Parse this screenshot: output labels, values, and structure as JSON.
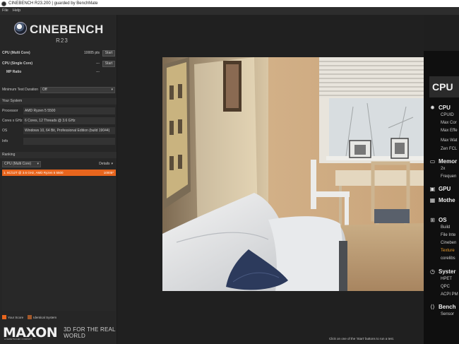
{
  "window": {
    "title": "CINEBENCH R23.200 | guarded by BenchMate"
  },
  "menu": {
    "items": [
      "File",
      "Help"
    ]
  },
  "logo": {
    "name": "CINEBENCH",
    "version": "R23"
  },
  "tests": {
    "multi": {
      "label": "CPU (Multi Core)",
      "score": "10005 pts",
      "button": "Start"
    },
    "single": {
      "label": "CPU (Single Core)",
      "score": "---",
      "button": "Start"
    },
    "ratio": {
      "label": "MP Ratio",
      "score": "---"
    }
  },
  "settings": {
    "duration_label": "Minimum Test Duration",
    "duration_value": "Off"
  },
  "system": {
    "header": "Your System",
    "rows": [
      {
        "label": "Processor",
        "value": "AMD Ryzen 5 5500"
      },
      {
        "label": "Cores x GHz",
        "value": "6 Cores, 12 Threads @ 3.6 GHz"
      },
      {
        "label": "OS",
        "value": "Windows 10, 64 Bit, Professional Edition (build 19044)"
      },
      {
        "label": "Info",
        "value": ""
      }
    ]
  },
  "ranking": {
    "header": "Ranking",
    "select_value": "CPU (Multi Core)",
    "details_label": "Details",
    "entries": [
      {
        "name": "1. 6C/12T @ 3.6 GHz, AMD Ryzen 5 5500",
        "score": "10005*"
      }
    ]
  },
  "legend": {
    "your_score": "Your Score",
    "identical": "Identical System",
    "your_score_color": "#e8651d",
    "identical_color": "#a3582a"
  },
  "footer": {
    "brand": "MAXON",
    "brand_sub": "A NEMETSCHEK COMPANY",
    "tagline": "3D FOR THE REAL WORLD"
  },
  "viewport": {
    "hint": "Click on one of the 'Start' buttons to run a test."
  },
  "info_panel": {
    "title": "CPU",
    "sections": [
      {
        "icon": "cpu-icon",
        "heading": "CPU",
        "items": [
          "CPUID",
          "Max Cor",
          "Max Effe",
          "Max Wat",
          "Zen FCL"
        ]
      },
      {
        "icon": "memory-icon",
        "heading": "Memor",
        "items": [
          "2x",
          "Frequen"
        ]
      },
      {
        "icon": "gpu-icon",
        "heading": "GPU",
        "items": []
      },
      {
        "icon": "motherboard-icon",
        "heading": "Mothe",
        "items": []
      },
      {
        "icon": "windows-icon",
        "heading": "OS",
        "items": [
          "Build",
          "File Inte",
          "Cineben",
          "Texture",
          "corelibs"
        ]
      },
      {
        "icon": "stopwatch-icon",
        "heading": "Syster",
        "items": [
          "HPET",
          "QPC",
          "ACPI PM"
        ]
      },
      {
        "icon": "benchmate-icon",
        "heading": "Bench",
        "items": [
          "Sensor"
        ]
      }
    ]
  },
  "colors": {
    "accent": "#e8651d",
    "highlight_text": "#e89a2a"
  }
}
